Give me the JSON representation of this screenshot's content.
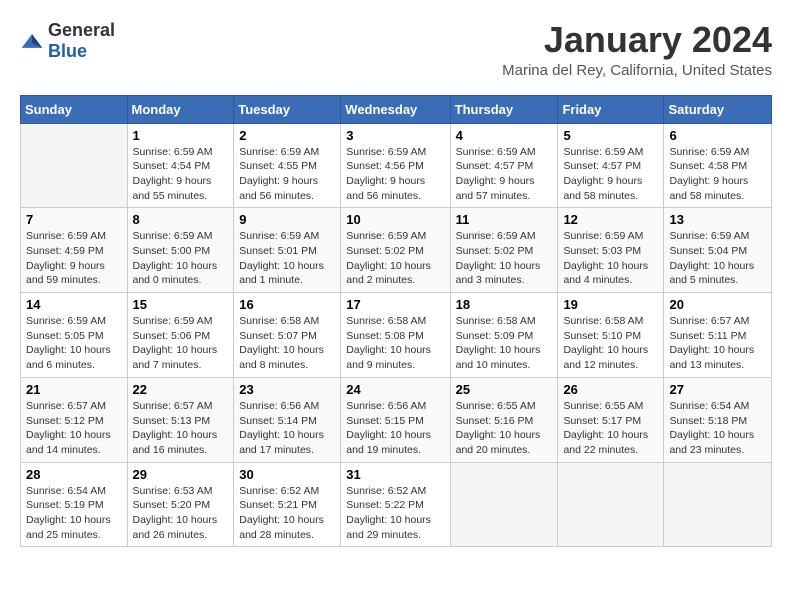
{
  "logo": {
    "general": "General",
    "blue": "Blue"
  },
  "title": "January 2024",
  "subtitle": "Marina del Rey, California, United States",
  "days_of_week": [
    "Sunday",
    "Monday",
    "Tuesday",
    "Wednesday",
    "Thursday",
    "Friday",
    "Saturday"
  ],
  "weeks": [
    [
      {
        "day": "",
        "sunrise": "",
        "sunset": "",
        "daylight": ""
      },
      {
        "day": "1",
        "sunrise": "Sunrise: 6:59 AM",
        "sunset": "Sunset: 4:54 PM",
        "daylight": "Daylight: 9 hours and 55 minutes."
      },
      {
        "day": "2",
        "sunrise": "Sunrise: 6:59 AM",
        "sunset": "Sunset: 4:55 PM",
        "daylight": "Daylight: 9 hours and 56 minutes."
      },
      {
        "day": "3",
        "sunrise": "Sunrise: 6:59 AM",
        "sunset": "Sunset: 4:56 PM",
        "daylight": "Daylight: 9 hours and 56 minutes."
      },
      {
        "day": "4",
        "sunrise": "Sunrise: 6:59 AM",
        "sunset": "Sunset: 4:57 PM",
        "daylight": "Daylight: 9 hours and 57 minutes."
      },
      {
        "day": "5",
        "sunrise": "Sunrise: 6:59 AM",
        "sunset": "Sunset: 4:57 PM",
        "daylight": "Daylight: 9 hours and 58 minutes."
      },
      {
        "day": "6",
        "sunrise": "Sunrise: 6:59 AM",
        "sunset": "Sunset: 4:58 PM",
        "daylight": "Daylight: 9 hours and 58 minutes."
      }
    ],
    [
      {
        "day": "7",
        "sunrise": "Sunrise: 6:59 AM",
        "sunset": "Sunset: 4:59 PM",
        "daylight": "Daylight: 9 hours and 59 minutes."
      },
      {
        "day": "8",
        "sunrise": "Sunrise: 6:59 AM",
        "sunset": "Sunset: 5:00 PM",
        "daylight": "Daylight: 10 hours and 0 minutes."
      },
      {
        "day": "9",
        "sunrise": "Sunrise: 6:59 AM",
        "sunset": "Sunset: 5:01 PM",
        "daylight": "Daylight: 10 hours and 1 minute."
      },
      {
        "day": "10",
        "sunrise": "Sunrise: 6:59 AM",
        "sunset": "Sunset: 5:02 PM",
        "daylight": "Daylight: 10 hours and 2 minutes."
      },
      {
        "day": "11",
        "sunrise": "Sunrise: 6:59 AM",
        "sunset": "Sunset: 5:02 PM",
        "daylight": "Daylight: 10 hours and 3 minutes."
      },
      {
        "day": "12",
        "sunrise": "Sunrise: 6:59 AM",
        "sunset": "Sunset: 5:03 PM",
        "daylight": "Daylight: 10 hours and 4 minutes."
      },
      {
        "day": "13",
        "sunrise": "Sunrise: 6:59 AM",
        "sunset": "Sunset: 5:04 PM",
        "daylight": "Daylight: 10 hours and 5 minutes."
      }
    ],
    [
      {
        "day": "14",
        "sunrise": "Sunrise: 6:59 AM",
        "sunset": "Sunset: 5:05 PM",
        "daylight": "Daylight: 10 hours and 6 minutes."
      },
      {
        "day": "15",
        "sunrise": "Sunrise: 6:59 AM",
        "sunset": "Sunset: 5:06 PM",
        "daylight": "Daylight: 10 hours and 7 minutes."
      },
      {
        "day": "16",
        "sunrise": "Sunrise: 6:58 AM",
        "sunset": "Sunset: 5:07 PM",
        "daylight": "Daylight: 10 hours and 8 minutes."
      },
      {
        "day": "17",
        "sunrise": "Sunrise: 6:58 AM",
        "sunset": "Sunset: 5:08 PM",
        "daylight": "Daylight: 10 hours and 9 minutes."
      },
      {
        "day": "18",
        "sunrise": "Sunrise: 6:58 AM",
        "sunset": "Sunset: 5:09 PM",
        "daylight": "Daylight: 10 hours and 10 minutes."
      },
      {
        "day": "19",
        "sunrise": "Sunrise: 6:58 AM",
        "sunset": "Sunset: 5:10 PM",
        "daylight": "Daylight: 10 hours and 12 minutes."
      },
      {
        "day": "20",
        "sunrise": "Sunrise: 6:57 AM",
        "sunset": "Sunset: 5:11 PM",
        "daylight": "Daylight: 10 hours and 13 minutes."
      }
    ],
    [
      {
        "day": "21",
        "sunrise": "Sunrise: 6:57 AM",
        "sunset": "Sunset: 5:12 PM",
        "daylight": "Daylight: 10 hours and 14 minutes."
      },
      {
        "day": "22",
        "sunrise": "Sunrise: 6:57 AM",
        "sunset": "Sunset: 5:13 PM",
        "daylight": "Daylight: 10 hours and 16 minutes."
      },
      {
        "day": "23",
        "sunrise": "Sunrise: 6:56 AM",
        "sunset": "Sunset: 5:14 PM",
        "daylight": "Daylight: 10 hours and 17 minutes."
      },
      {
        "day": "24",
        "sunrise": "Sunrise: 6:56 AM",
        "sunset": "Sunset: 5:15 PM",
        "daylight": "Daylight: 10 hours and 19 minutes."
      },
      {
        "day": "25",
        "sunrise": "Sunrise: 6:55 AM",
        "sunset": "Sunset: 5:16 PM",
        "daylight": "Daylight: 10 hours and 20 minutes."
      },
      {
        "day": "26",
        "sunrise": "Sunrise: 6:55 AM",
        "sunset": "Sunset: 5:17 PM",
        "daylight": "Daylight: 10 hours and 22 minutes."
      },
      {
        "day": "27",
        "sunrise": "Sunrise: 6:54 AM",
        "sunset": "Sunset: 5:18 PM",
        "daylight": "Daylight: 10 hours and 23 minutes."
      }
    ],
    [
      {
        "day": "28",
        "sunrise": "Sunrise: 6:54 AM",
        "sunset": "Sunset: 5:19 PM",
        "daylight": "Daylight: 10 hours and 25 minutes."
      },
      {
        "day": "29",
        "sunrise": "Sunrise: 6:53 AM",
        "sunset": "Sunset: 5:20 PM",
        "daylight": "Daylight: 10 hours and 26 minutes."
      },
      {
        "day": "30",
        "sunrise": "Sunrise: 6:52 AM",
        "sunset": "Sunset: 5:21 PM",
        "daylight": "Daylight: 10 hours and 28 minutes."
      },
      {
        "day": "31",
        "sunrise": "Sunrise: 6:52 AM",
        "sunset": "Sunset: 5:22 PM",
        "daylight": "Daylight: 10 hours and 29 minutes."
      },
      {
        "day": "",
        "sunrise": "",
        "sunset": "",
        "daylight": ""
      },
      {
        "day": "",
        "sunrise": "",
        "sunset": "",
        "daylight": ""
      },
      {
        "day": "",
        "sunrise": "",
        "sunset": "",
        "daylight": ""
      }
    ]
  ]
}
